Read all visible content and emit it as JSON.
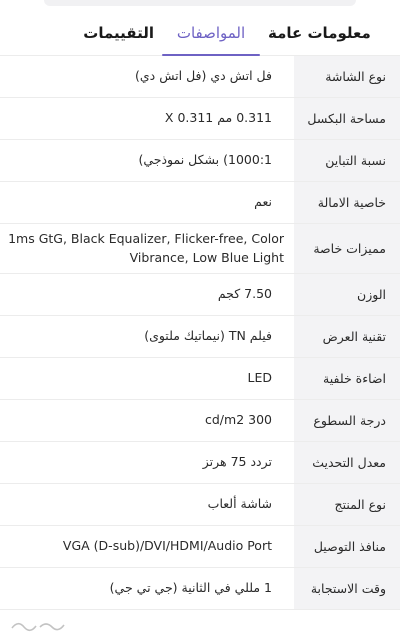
{
  "tabs": [
    {
      "label": "معلومات عامة"
    },
    {
      "label": "المواصفات"
    },
    {
      "label": "التقييمات"
    }
  ],
  "specs": [
    {
      "label": "نوع الشاشة",
      "value": "فل اتش دي (فل اتش دي)"
    },
    {
      "label": "مساحة البكسل",
      "value": "0.311 مم X 0.311"
    },
    {
      "label": "نسبة التباين",
      "value": "1000:1) بشكل نموذجي)"
    },
    {
      "label": "خاصية الامالة",
      "value": "نعم"
    },
    {
      "label": "مميزات خاصة",
      "value": "1ms GtG, Black Equalizer, Flicker-free, Color Vibrance, Low Blue Light"
    },
    {
      "label": "الوزن",
      "value": "7.50 كجم"
    },
    {
      "label": "تقنية العرض",
      "value": "فيلم TN (نيماتيك ملتوى)"
    },
    {
      "label": "اضاءة خلفية",
      "value": "LED"
    },
    {
      "label": "درجة السطوع",
      "value": "300 cd/m2"
    },
    {
      "label": "معدل التحديث",
      "value": "تردد 75 هرتز"
    },
    {
      "label": "نوع المنتج",
      "value": "شاشة ألعاب"
    },
    {
      "label": "منافذ التوصيل",
      "value": "VGA (D-sub)/DVI/HDMI/Audio Port"
    },
    {
      "label": "وقت الاستجابة",
      "value": "1 مللي في الثانية (جي تي جي)"
    }
  ]
}
